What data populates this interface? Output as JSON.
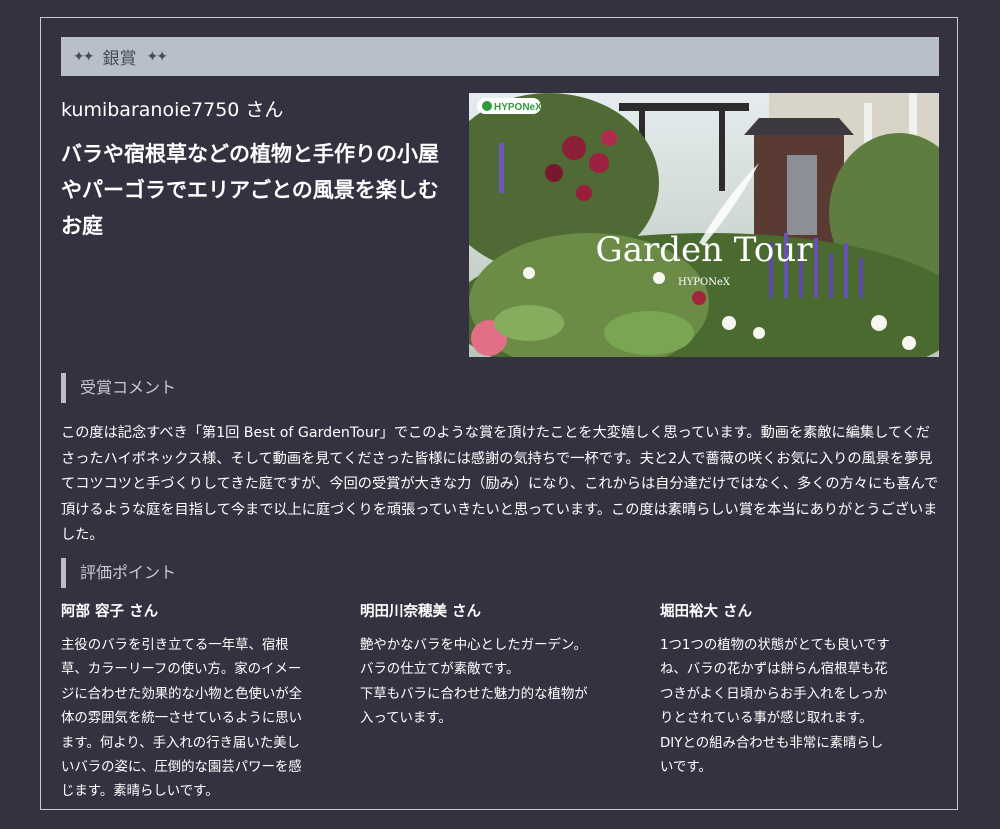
{
  "award": {
    "title": "銀賞",
    "sparkle_left": "✦✦",
    "sparkle_right": "✦✦"
  },
  "user": {
    "name": "kumibaranoie7750 さん"
  },
  "headline": "バラや宿根草などの植物と手作りの小屋やパーゴラでエリアごとの風景を楽しむお庭",
  "photo": {
    "logo": "HYPONeX",
    "title": "Garden Tour",
    "subtitle": "HYPONeX"
  },
  "comment_section": {
    "heading": "受賞コメント",
    "text": "この度は記念すべき「第1回 Best of GardenTour」でこのような賞を頂けたことを大変嬉しく思っています。動画を素敵に編集してくださったハイポネックス様、そして動画を見てくださった皆様には感謝の気持ちで一杯です。夫と2人で薔薇の咲くお気に入りの風景を夢見てコツコツと手づくりしてきた庭ですが、今回の受賞が大きな力（励み）になり、これからは自分達だけではなく、多くの方々にも喜んで頂けるような庭を目指して今まで以上に庭づくりを頑張っていきたいと思っています。この度は素晴らしい賞を本当にありがとうございました。"
  },
  "evaluation": {
    "heading": "評価ポイント",
    "judges": [
      {
        "name": "阿部 容子 さん",
        "text": "主役のバラを引き立てる一年草、宿根\n草、カラーリーフの使い方。家のイメー\nジに合わせた効果的な小物と色使いが全\n体の雰囲気を統一させているように思い\nます。何より、手入れの行き届いた美し\nいバラの姿に、圧倒的な園芸パワーを感\nじます。素晴らしいです。"
      },
      {
        "name": "明田川奈穂美 さん",
        "text": "艶やかなバラを中心としたガーデン。\nバラの仕立てが素敵です。\n下草もバラに合わせた魅力的な植物が\n入っています。"
      },
      {
        "name": "堀田裕大 さん",
        "text": "1つ1つの植物の状態がとても良いです\nね、バラの花かずは餅らん宿根草も花\nつきがよく日頃からお手入れをしっか\nりとされている事が感じ取れます。\nDIYとの組み合わせも非常に素晴らし\nいです。"
      }
    ]
  },
  "colors": {
    "background": "#343241",
    "bar": "#b8bfcb",
    "accent": "#b8bfcb"
  }
}
